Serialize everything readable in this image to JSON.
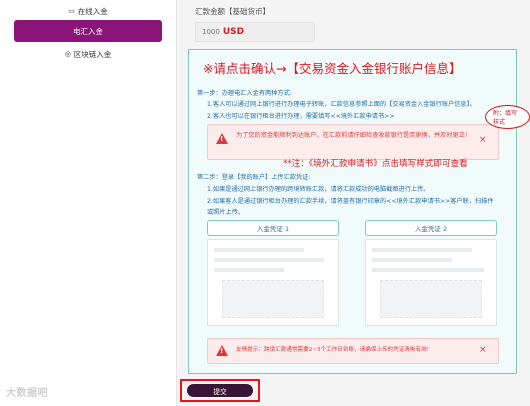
{
  "sidebar": {
    "items": [
      {
        "label": "在线入金",
        "icon": "monitor-icon",
        "glyph": "▭"
      },
      {
        "label": "电汇入金",
        "active": true
      },
      {
        "label": "区块链入金",
        "icon": "blockchain-icon",
        "glyph": "◎"
      }
    ],
    "watermark": "大数据吧"
  },
  "amount": {
    "label": "汇款金额【基础货币】",
    "value": "1000",
    "currency": "USD"
  },
  "panel": {
    "headline": "※请点击确认→【交易资金入金银行账户信息】",
    "step1_title": "第一步：办理电汇入金有两种方式:",
    "step1_line1": "1.客人可以通过网上银行进行办理电子转账，汇款信息参照上面的【交易资金入金银行账户信息】。",
    "step1_line2": "2.客人也可以在银行柜台进行办理，需要填写<<境外汇款申请书>>",
    "circled_note": "附：填写样式",
    "alert1_text": "为了您的资金能顺利到达账户，在汇款前请仔细检查收款银行是否更换，并及时更正!",
    "alert_close": "×",
    "star_note": "**注：《境外汇款申请书》点击填写样式即可查看",
    "step2_title": "第二步：登录【我的账户】上传汇款凭证:",
    "step2_line1": "1.如果是通过网上银行办理的跨境转账汇款，请将汇款成功的电脑截图进行上传。",
    "step2_line2": "2.如果客人是通过银行柜台办理的汇款手续，请将盖有银行印章的<<境外汇款申请书>>客户联，扫描件",
    "step2_line3": "或照片上传。",
    "voucher1": "入金凭证 1",
    "voucher2": "入金凭证 2",
    "alert2_text": "友情提示：跨境汇款通常需要2~3个工作日到账，请确保上传的凭证清晰有效!"
  },
  "submit": {
    "label": "提交"
  },
  "colors": {
    "brand": "#8a1477",
    "alert_red": "#e3171e",
    "panel_border": "#7ec9c6",
    "link_blue": "#2a6fa8"
  }
}
